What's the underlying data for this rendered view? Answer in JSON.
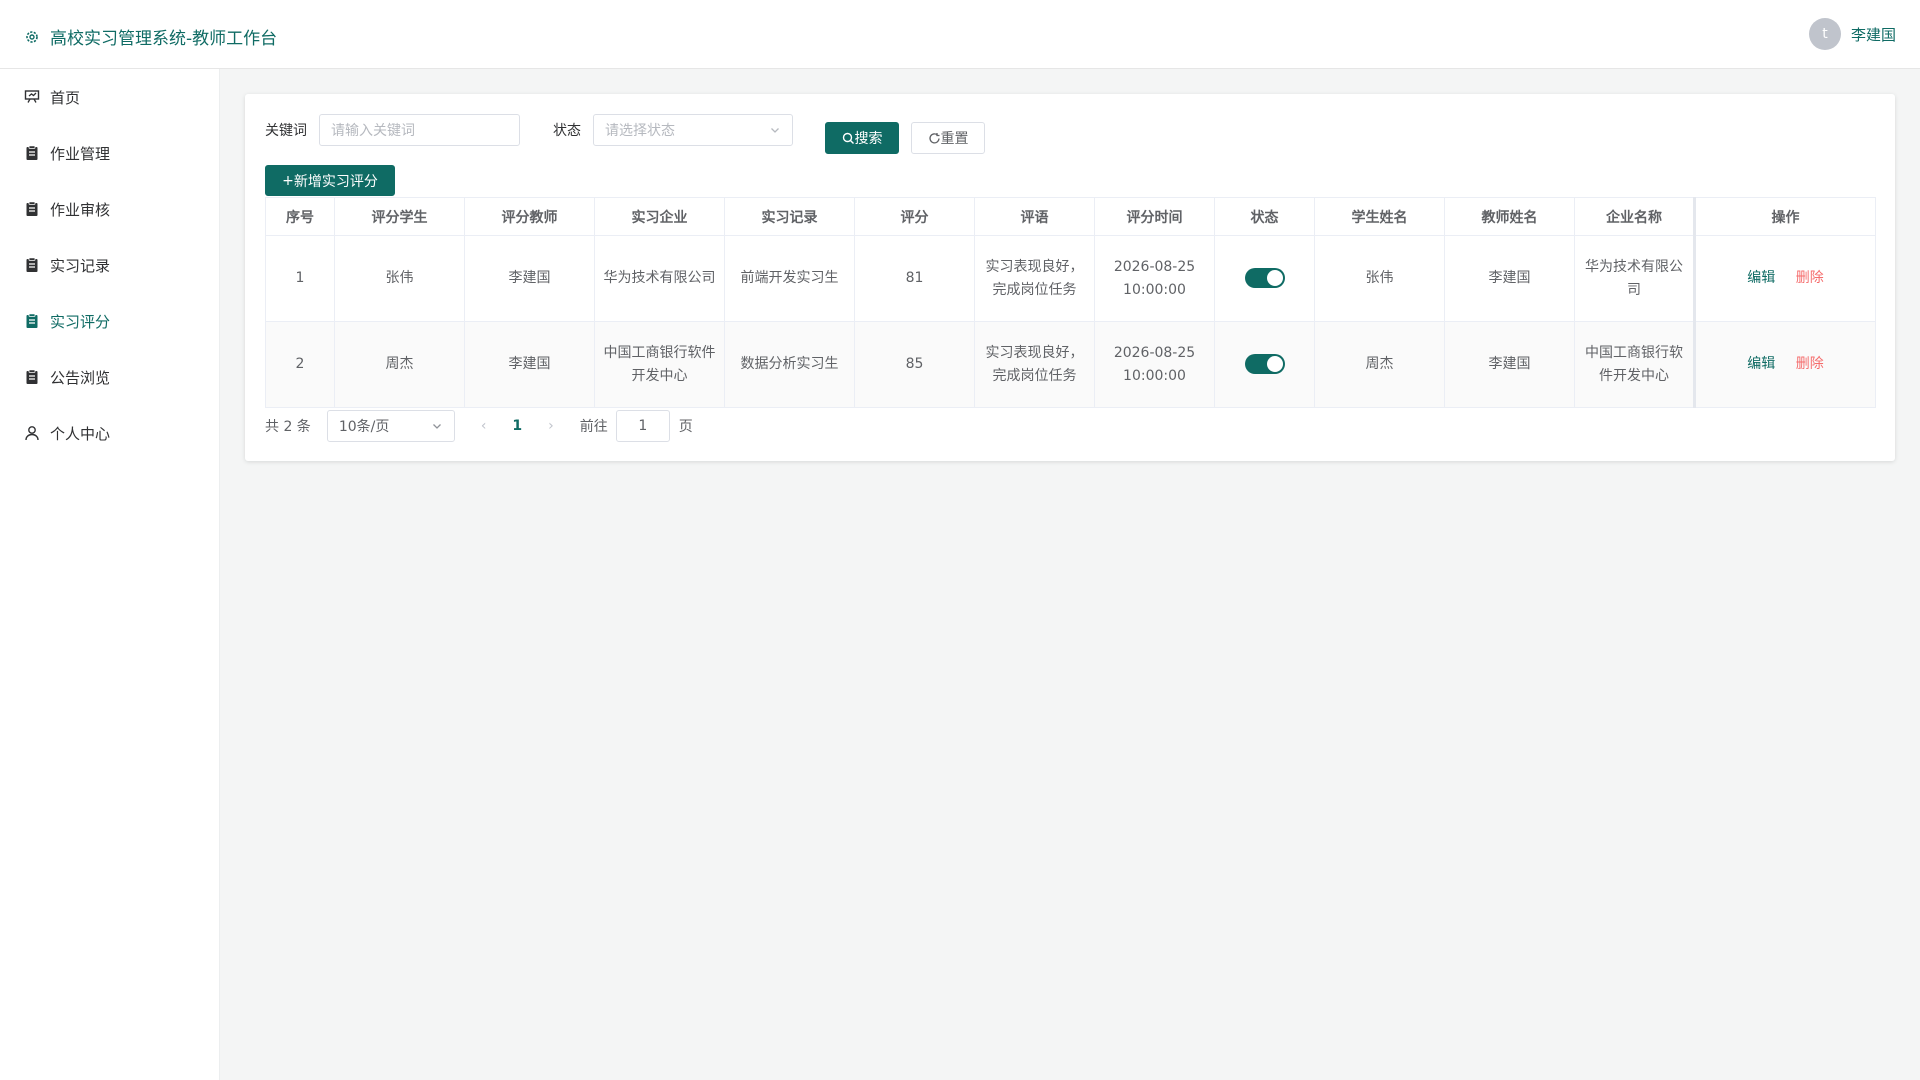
{
  "header": {
    "title": "高校实习管理系统-教师工作台",
    "avatar_letter": "t",
    "user_name": "李建国"
  },
  "sidebar": {
    "items": [
      {
        "label": "首页",
        "icon": "presentation-icon"
      },
      {
        "label": "作业管理",
        "icon": "clipboard-icon"
      },
      {
        "label": "作业审核",
        "icon": "clipboard-icon"
      },
      {
        "label": "实习记录",
        "icon": "clipboard-icon"
      },
      {
        "label": "实习评分",
        "icon": "clipboard-icon",
        "active": true
      },
      {
        "label": "公告浏览",
        "icon": "clipboard-icon"
      },
      {
        "label": "个人中心",
        "icon": "user-icon"
      }
    ]
  },
  "filter": {
    "keyword_label": "关键词",
    "keyword_placeholder": "请输入关键词",
    "status_label": "状态",
    "status_placeholder": "请选择状态",
    "search_label": "搜索",
    "reset_label": "重置"
  },
  "add_label": "新增实习评分",
  "table": {
    "headers": [
      "序号",
      "评分学生",
      "评分教师",
      "实习企业",
      "实习记录",
      "评分",
      "评语",
      "评分时间",
      "状态",
      "学生姓名",
      "教师姓名",
      "企业名称",
      "操作"
    ],
    "rows": [
      {
        "no": "1",
        "student": "张伟",
        "teacher": "李建国",
        "company": "华为技术有限公司",
        "record": "前端开发实习生",
        "score": "81",
        "comment": "实习表现良好，完成岗位任务",
        "time": "2026-08-25 10:00:00",
        "status_on": true,
        "student_name": "张伟",
        "teacher_name": "李建国",
        "company_name": "华为技术有限公司"
      },
      {
        "no": "2",
        "student": "周杰",
        "teacher": "李建国",
        "company": "中国工商银行软件开发中心",
        "record": "数据分析实习生",
        "score": "85",
        "comment": "实习表现良好，完成岗位任务",
        "time": "2026-08-25 10:00:00",
        "status_on": true,
        "student_name": "周杰",
        "teacher_name": "李建国",
        "company_name": "中国工商银行软件开发中心"
      }
    ],
    "edit_label": "编辑",
    "delete_label": "删除"
  },
  "pagination": {
    "total_text": "共 2 条",
    "page_size": "10条/页",
    "current_page": "1",
    "goto_label": "前往",
    "goto_value": "1",
    "page_suffix": "页"
  },
  "colors": {
    "primary": "#0f6b64",
    "danger": "#f56c6c"
  }
}
